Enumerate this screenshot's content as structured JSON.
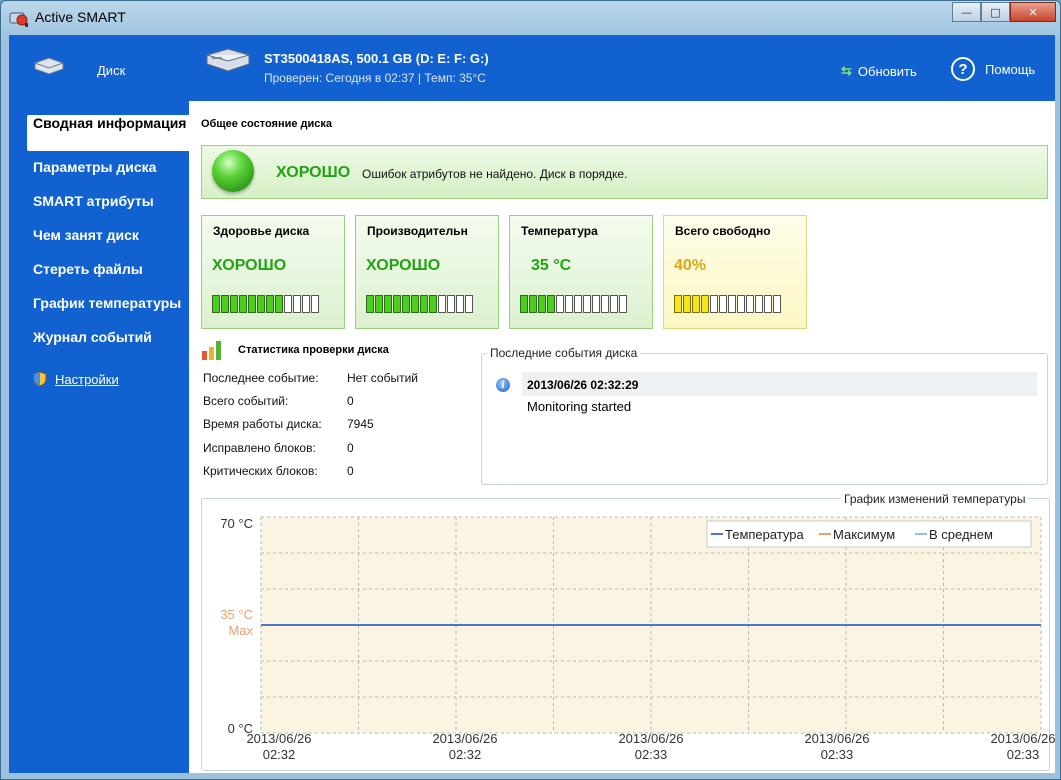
{
  "window": {
    "title": "Active SMART",
    "minimize": "—",
    "maximize": "□",
    "close": "✕"
  },
  "header": {
    "disk_label": "Диск",
    "model": "ST3500418AS, 500.1 GB (D: E: F: G:)",
    "checked": "Проверен: Сегодня в 02:37 | Темп: 35°C",
    "refresh_label": "Обновить",
    "help_label": "Помощь",
    "help_glyph": "?",
    "refresh_glyph": "⇆"
  },
  "sidebar": {
    "items": [
      {
        "label": "Сводная информация",
        "active": true
      },
      {
        "label": "Параметры диска"
      },
      {
        "label": "SMART атрибуты"
      },
      {
        "label": "Чем занят диск"
      },
      {
        "label": "Стереть файлы"
      },
      {
        "label": "График температуры"
      },
      {
        "label": "Журнал событий"
      }
    ],
    "settings_label": "Настройки"
  },
  "main": {
    "section_title": "Общее состояние диска",
    "status": {
      "word": "ХОРОШО",
      "message": "Ошибок атрибутов не найдено. Диск в порядке."
    },
    "cards": [
      {
        "title": "Здоровье диска",
        "value": "ХОРОШО",
        "level": 8,
        "segments": 12
      },
      {
        "title": "Производительн",
        "value": "ХОРОШО",
        "level": 8,
        "segments": 12
      },
      {
        "title": "Температура",
        "value": "35 °C",
        "level": 4,
        "segments": 12
      },
      {
        "title": "Всего свободно",
        "value": "40%",
        "level": 4,
        "segments": 12
      }
    ],
    "stats": {
      "title": "Статистика проверки диска",
      "rows": [
        {
          "label": "Последнее событие:",
          "value": "Нет событий"
        },
        {
          "label": "Всего событий:",
          "value": "0"
        },
        {
          "label": "Время работы диска:",
          "value": "7945"
        },
        {
          "label": "Исправлено блоков:",
          "value": "0"
        },
        {
          "label": "Критических блоков:",
          "value": "0"
        }
      ]
    },
    "events": {
      "title": "Последние события диска",
      "items": [
        {
          "time": "2013/06/26 02:32:29",
          "message": "Monitoring started",
          "icon": "info-icon"
        }
      ]
    }
  },
  "chart_data": {
    "type": "line",
    "title": "График изменений температуры",
    "y_tick_labels": [
      "70 °C",
      "35 °C",
      "Max",
      "0 °C"
    ],
    "ylim": [
      0,
      70
    ],
    "x_tick_labels": [
      [
        "2013/06/26",
        "02:32"
      ],
      [
        "2013/06/26",
        "02:32"
      ],
      [
        "2013/06/26",
        "02:33"
      ],
      [
        "2013/06/26",
        "02:33"
      ],
      [
        "2013/06/26",
        "02:33"
      ]
    ],
    "legend": [
      "Температура",
      "Максимум",
      "В среднем"
    ],
    "legend_colors": [
      "#4a78c8",
      "#e8a070",
      "#8fbfe6"
    ],
    "series": [
      {
        "name": "Температура",
        "values": [
          35,
          35,
          35,
          35,
          35
        ]
      }
    ],
    "max_value": 35,
    "grid": true,
    "legend_position": "top-right"
  }
}
